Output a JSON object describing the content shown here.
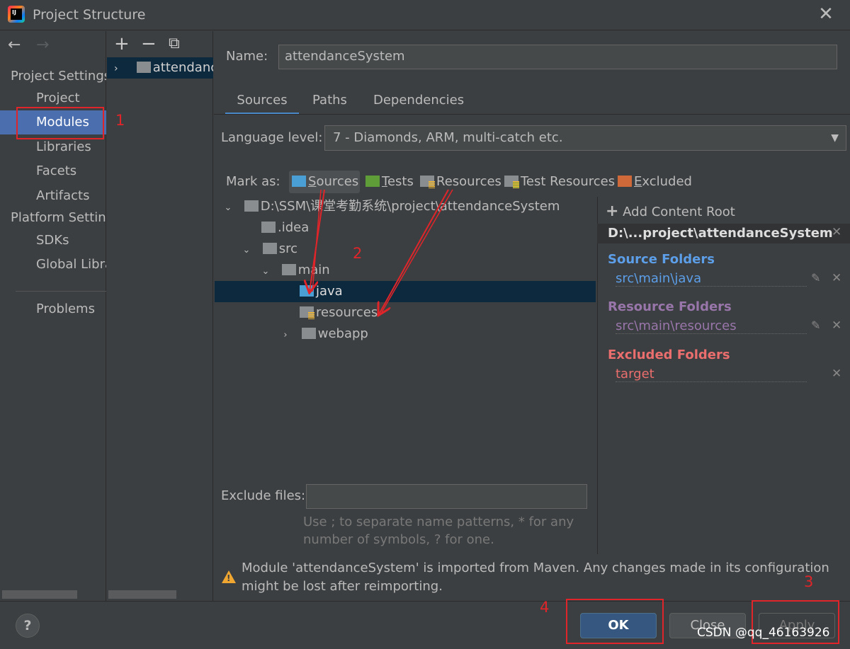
{
  "window": {
    "title": "Project Structure",
    "app_icon_text": "IJ",
    "close_glyph": "✕"
  },
  "nav": {
    "back_glyph": "←",
    "forward_glyph": "→",
    "project_settings_header": "Project Settings",
    "items_project": [
      "Project",
      "Modules",
      "Libraries",
      "Facets",
      "Artifacts"
    ],
    "selected": "Modules",
    "platform_settings_header": "Platform Settings",
    "items_platform": [
      "SDKs",
      "Global Libraries"
    ],
    "problems": "Problems"
  },
  "module_list": {
    "add_glyph": "+",
    "remove_glyph": "−",
    "copy_glyph": "⧉",
    "modules": [
      "attendanceSystem"
    ]
  },
  "module": {
    "name_label": "Name:",
    "name_value": "attendanceSystem",
    "tabs": [
      "Sources",
      "Paths",
      "Dependencies"
    ],
    "active_tab": "Sources",
    "language_level_label": "Language level:",
    "language_level_value": "7 - Diamonds, ARM, multi-catch etc.",
    "mark_as_label": "Mark as:",
    "mark_as": [
      {
        "label": "Sources",
        "mnemonic": "S",
        "rest": "ources",
        "color": "#4a9fd5"
      },
      {
        "label": "Tests",
        "mnemonic": "T",
        "rest": "ests",
        "color": "#5e9d38"
      },
      {
        "label": "Resources",
        "mnemonic": "",
        "rest": "Resources",
        "color": "#8a8d8f"
      },
      {
        "label": "Test Resources",
        "mnemonic": "",
        "rest": "Test Resources",
        "color": "#8a8d8f"
      },
      {
        "label": "Excluded",
        "mnemonic": "E",
        "rest": "xcluded",
        "color": "#d0693a"
      }
    ],
    "tree": [
      {
        "label": "D:\\SSM\\课堂考勤系统\\project\\attendanceSystem",
        "depth": 0,
        "expander": "⌄",
        "kind": "plain"
      },
      {
        "label": ".idea",
        "depth": 1,
        "expander": "",
        "kind": "plain"
      },
      {
        "label": "src",
        "depth": 1,
        "expander": "⌄",
        "kind": "plain"
      },
      {
        "label": "main",
        "depth": 2,
        "expander": "⌄",
        "kind": "plain"
      },
      {
        "label": "java",
        "depth": 3,
        "expander": "",
        "kind": "source"
      },
      {
        "label": "resources",
        "depth": 3,
        "expander": "",
        "kind": "resource"
      },
      {
        "label": "webapp",
        "depth": 3,
        "expander": "›",
        "kind": "plain"
      }
    ],
    "selected_tree_item": "java",
    "exclude_files_label": "Exclude files:",
    "exclude_files_value": "",
    "exclude_hint_1": "Use ; to separate name patterns, * for any",
    "exclude_hint_2": "number of symbols, ? for one."
  },
  "content_root": {
    "add_label": "Add Content Root",
    "add_glyph": "+",
    "root_path": "D:\\...project\\attendanceSystem",
    "source_folders_label": "Source Folders",
    "source_folders": [
      "src\\main\\java"
    ],
    "resource_folders_label": "Resource Folders",
    "resource_folders": [
      "src\\main\\resources"
    ],
    "excluded_folders_label": "Excluded Folders",
    "excluded_folders": [
      "target"
    ],
    "colors": {
      "source": "#5c9ee8",
      "resource": "#9876aa",
      "excluded": "#eb6e6e"
    },
    "remove_glyph": "✕",
    "edit_glyph": "✎"
  },
  "warning": {
    "line1": "Module 'attendanceSystem' is imported from Maven. Any changes made in its configuration",
    "line2": "might be lost after reimporting."
  },
  "buttons": {
    "help": "?",
    "ok": "OK",
    "close": "Close",
    "apply": "Apply"
  },
  "annotations": {
    "step1": "1",
    "step2": "2",
    "step3": "3",
    "step4": "4",
    "color": "#e0252a"
  },
  "watermark": "CSDN @qq_46163926"
}
